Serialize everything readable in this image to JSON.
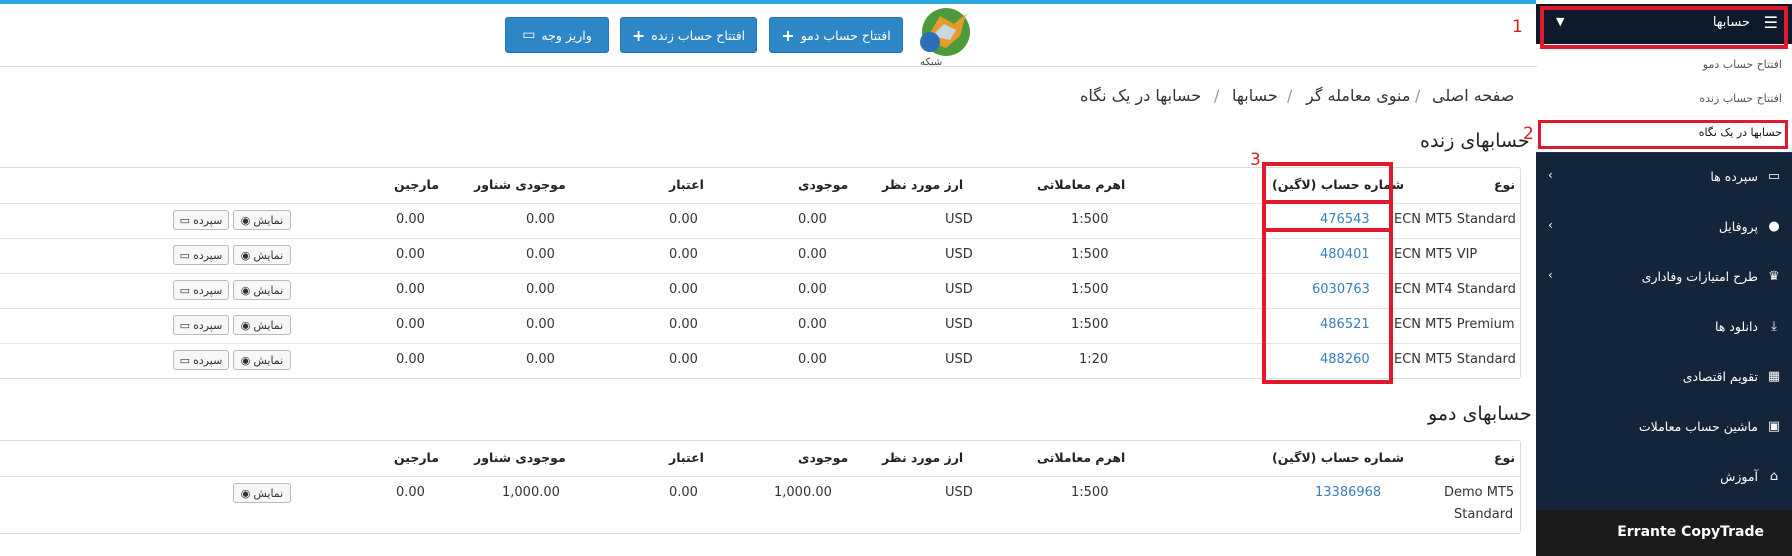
{
  "header": {
    "logo_alt": "شبکه",
    "buttons": {
      "demo": "افتتاح حساب دمو",
      "live": "افتتاح حساب زنده",
      "deposit": "واریز وجه"
    }
  },
  "breadcrumb": [
    "صفحه اصلی",
    "منوی معامله گر",
    "حسابها",
    "حسابها در یک نگاه"
  ],
  "sidebar": {
    "head_label": "حسابها",
    "sub_items": [
      "افتتاح حساب دمو",
      "افتتاح حساب زنده",
      "حسابها در یک نگاه"
    ],
    "items": [
      {
        "label": "سپرده ها",
        "icon": "card-icon",
        "chevron": true
      },
      {
        "label": "پروفایل",
        "icon": "user-icon",
        "chevron": true
      },
      {
        "label": "طرح امتیازات وفاداری",
        "icon": "trophy-icon",
        "chevron": true
      },
      {
        "label": "دانلود ها",
        "icon": "download-icon",
        "chevron": false
      },
      {
        "label": "تقویم اقتصادی",
        "icon": "calendar-icon",
        "chevron": false
      },
      {
        "label": "ماشین حساب معاملات",
        "icon": "calculator-icon",
        "chevron": false
      },
      {
        "label": "آموزش",
        "icon": "bank-icon",
        "chevron": false
      }
    ],
    "footer": "Errante CopyTrade"
  },
  "annotations": [
    "1",
    "2",
    "3"
  ],
  "live": {
    "title": "حسابهای زنده",
    "headers": [
      "نوع",
      "شماره حساب (لاگین)",
      "اهرم معاملاتی",
      "ارز مورد نظر",
      "موجودی",
      "اعتبار",
      "موجودی شناور",
      "مارجین"
    ],
    "rows": [
      [
        "ECN MT5 Standard",
        "476543",
        "1:500",
        "USD",
        "0.00",
        "0.00",
        "0.00",
        "0.00"
      ],
      [
        "ECN MT5 VIP",
        "480401",
        "1:500",
        "USD",
        "0.00",
        "0.00",
        "0.00",
        "0.00"
      ],
      [
        "ECN MT4 Standard",
        "6030763",
        "1:500",
        "USD",
        "0.00",
        "0.00",
        "0.00",
        "0.00"
      ],
      [
        "ECN MT5 Premium",
        "486521",
        "1:500",
        "USD",
        "0.00",
        "0.00",
        "0.00",
        "0.00"
      ],
      [
        "ECN MT5 Standard",
        "488260",
        "1:20",
        "USD",
        "0.00",
        "0.00",
        "0.00",
        "0.00"
      ]
    ],
    "show_label": "نمایش",
    "deposit_label": "سپرده"
  },
  "demo": {
    "title": "حسابهای دمو",
    "headers": [
      "نوع",
      "شماره حساب (لاگین)",
      "اهرم معاملاتی",
      "ارز مورد نظر",
      "موجودی",
      "اعتبار",
      "موجودی شناور",
      "مارجین"
    ],
    "rows": [
      [
        "Demo MT5",
        "Standard",
        "13386968",
        "1:500",
        "USD",
        "1,000.00",
        "0.00",
        "1,000.00",
        "0.00"
      ]
    ],
    "show_label": "نمایش"
  }
}
